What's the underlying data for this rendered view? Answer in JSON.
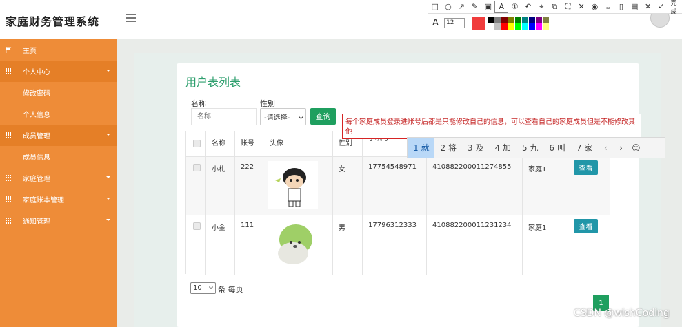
{
  "app": {
    "title": "家庭财务管理系统"
  },
  "sidebar": {
    "items": [
      {
        "label": "主页",
        "icon": "flag-icon"
      },
      {
        "label": "个人中心",
        "icon": "grid-icon",
        "expand": true
      },
      {
        "label": "修改密码"
      },
      {
        "label": "个人信息"
      },
      {
        "label": "成员管理",
        "icon": "grid-icon",
        "expand": true
      },
      {
        "label": "成员信息"
      },
      {
        "label": "家庭管理",
        "icon": "grid-icon",
        "expand": true
      },
      {
        "label": "家庭账本管理",
        "icon": "grid-icon",
        "expand": true
      },
      {
        "label": "通知管理",
        "icon": "grid-icon",
        "expand": true
      }
    ]
  },
  "panel": {
    "title": "用户表列表"
  },
  "search": {
    "name_label": "名称",
    "name_placeholder": "名称",
    "gender_label": "性别",
    "gender_value": "-请选择-",
    "query_label": "查询"
  },
  "table": {
    "headers": [
      "名称",
      "账号",
      "头像",
      "性别",
      "手机号"
    ],
    "rows": [
      {
        "name": "小札",
        "account": "222",
        "gender": "女",
        "phone": "17754548971",
        "id": "410882200011274855",
        "family": "家庭1",
        "action": "查看"
      },
      {
        "name": "小金",
        "account": "111",
        "gender": "男",
        "phone": "17796312333",
        "id": "410882200011231234",
        "family": "家庭1",
        "action": "查看"
      }
    ]
  },
  "pagination": {
    "page_size": "10",
    "per_page_text": "条 每页",
    "current_page": "1"
  },
  "annotation": {
    "text": "每个家庭成员登录进账号后都是只能修改自己的信息，可以查看自己的家庭成员但是不能修改其他"
  },
  "ime": {
    "candidates": [
      {
        "n": "1",
        "c": "就"
      },
      {
        "n": "2",
        "c": "将"
      },
      {
        "n": "3",
        "c": "及"
      },
      {
        "n": "4",
        "c": "加"
      },
      {
        "n": "5",
        "c": "九"
      },
      {
        "n": "6",
        "c": "叫"
      },
      {
        "n": "7",
        "c": "家"
      }
    ]
  },
  "toolbar": {
    "tools": [
      "rect-icon",
      "circle-icon",
      "arrow-icon",
      "pen-icon",
      "mosaic-icon",
      "text-icon",
      "number-icon",
      "undo-icon",
      "pin-icon",
      "copy-icon",
      "scan-icon",
      "eraser-icon",
      "record-icon",
      "download-icon",
      "phone-icon",
      "save-icon",
      "long-shot-icon",
      "close-icon",
      "check-icon"
    ],
    "done_label": "完成",
    "font_size": "12",
    "current_color": "#f03c3c",
    "palette": [
      "#000000",
      "#808080",
      "#800000",
      "#808000",
      "#008000",
      "#008080",
      "#000080",
      "#800080",
      "#808040",
      "#ffffff",
      "#c0c0c0",
      "#ff0000",
      "#ffff00",
      "#00ff00",
      "#00ffff",
      "#0000ff",
      "#ff00ff",
      "#ffff80"
    ]
  },
  "watermark": "CSDN @wishCoding"
}
